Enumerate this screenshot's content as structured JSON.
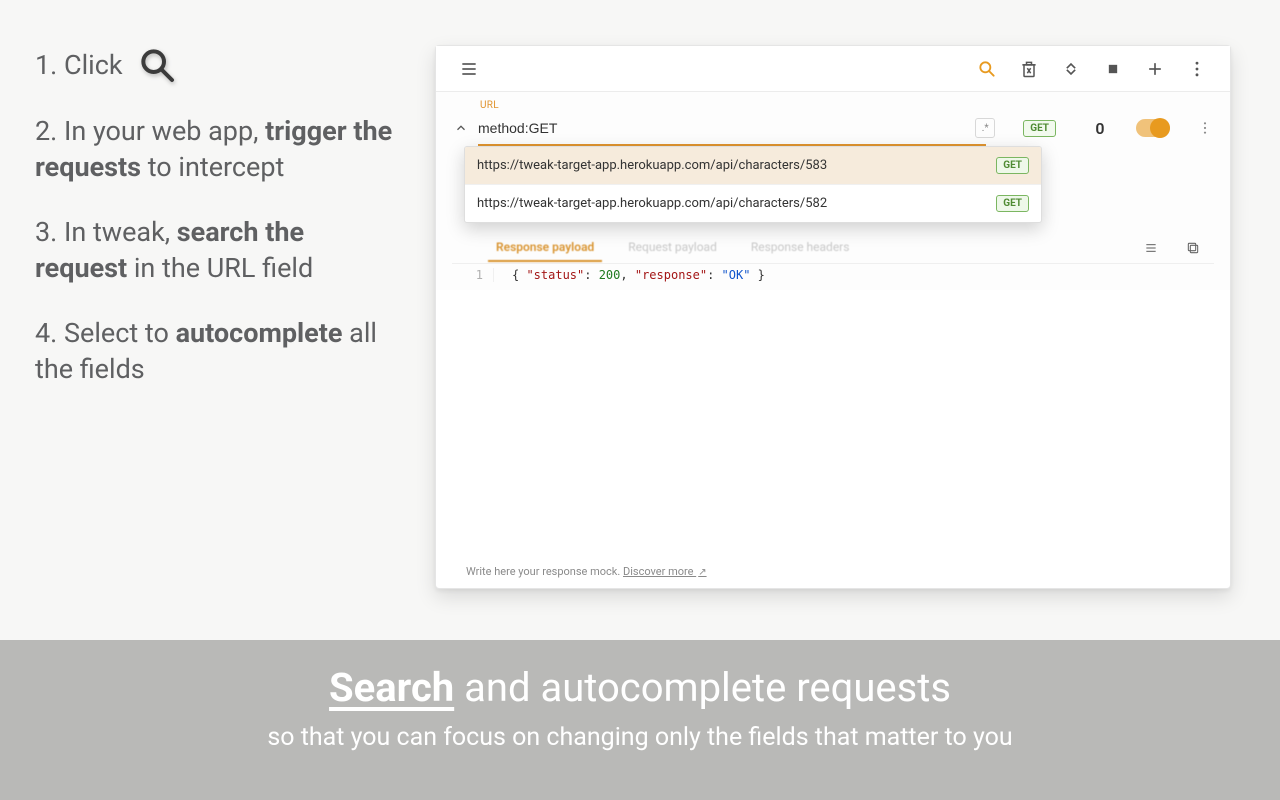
{
  "instructions": {
    "step1_prefix": "1. Click ",
    "step2_a": "2. In your web app, ",
    "step2_b": "trigger the requests",
    "step2_c": " to intercept",
    "step3_a": "3. In tweak, ",
    "step3_b": "search the request",
    "step3_c": " in the URL field",
    "step4_a": "4. Select to ",
    "step4_b": "autocomplete",
    "step4_c": " all the fields"
  },
  "toolbar": {
    "icons": {
      "hamburger": "hamburger-icon",
      "search": "search-icon",
      "delete": "delete-x-icon",
      "collapse": "collapse-icon",
      "stop": "stop-icon",
      "add": "plus-icon",
      "more": "more-vert-icon"
    }
  },
  "rule": {
    "url_label": "URL",
    "method_text": "method:GET",
    "regex_symbol": ".*",
    "method_chip": "GET",
    "count": "0"
  },
  "dropdown": {
    "items": [
      {
        "url": "https://tweak-target-app.herokuapp.com/api/characters/583",
        "method": "GET",
        "selected": true
      },
      {
        "url": "https://tweak-target-app.herokuapp.com/api/characters/582",
        "method": "GET",
        "selected": false
      }
    ]
  },
  "tabs": {
    "active": "Response payload",
    "t2": "Request payload",
    "t3": "Response headers"
  },
  "code": {
    "line_no": "1",
    "brace_open": "{ ",
    "k1": "\"status\"",
    "colon1": ": ",
    "v1": "200",
    "comma": ", ",
    "k2": "\"response\"",
    "colon2": ": ",
    "v2": "\"OK\"",
    "brace_close": " }"
  },
  "footer": {
    "hint": "Write here your response mock. ",
    "link": "Discover more "
  },
  "banner": {
    "bold": "Search",
    "rest": " and autocomplete requests",
    "sub": "so that you can focus on changing only the fields that matter to you"
  }
}
